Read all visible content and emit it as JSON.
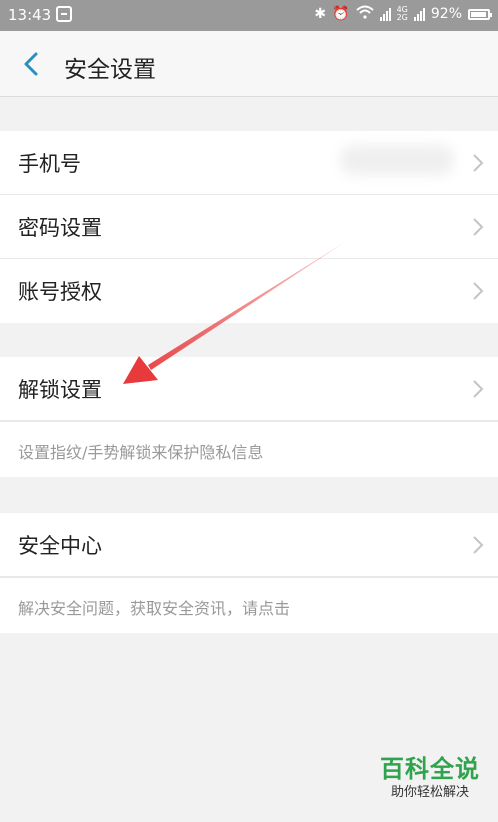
{
  "status_bar": {
    "time": "13:43",
    "battery": "92%",
    "net_tag_top": "4G",
    "net_tag_bottom": "2G"
  },
  "header": {
    "title": "安全设置"
  },
  "group1": {
    "items": [
      {
        "label": "手机号"
      },
      {
        "label": "密码设置"
      },
      {
        "label": "账号授权"
      }
    ]
  },
  "group2": {
    "item": {
      "label": "解锁设置"
    },
    "description": "设置指纹/手势解锁来保护隐私信息"
  },
  "group3": {
    "item": {
      "label": "安全中心"
    },
    "description": "解决安全问题，获取安全资讯，请点击"
  },
  "watermark": {
    "title": "百科全说",
    "subtitle": "助你轻松解决"
  },
  "colors": {
    "annotation_arrow": "#e8393c",
    "back_icon": "#2a8ec0",
    "watermark_green": "#2fa34d"
  }
}
